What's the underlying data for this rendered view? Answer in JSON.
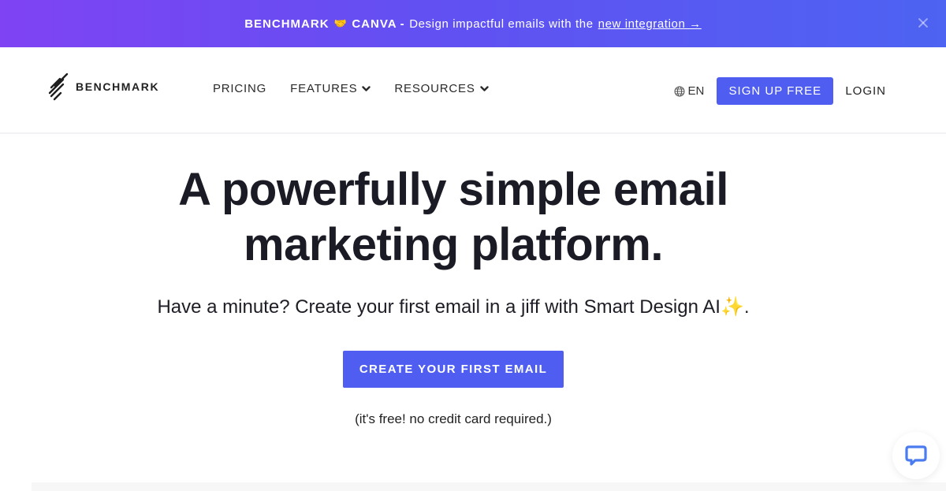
{
  "promo": {
    "brand_left": "BENCHMARK",
    "handshake_icon": "🤝",
    "brand_right": "CANVA",
    "separator": "-",
    "message": "Design impactful emails with the",
    "link_text": "new integration →",
    "close_icon": "close-icon",
    "colors": {
      "gradient_start": "#7f43f3",
      "gradient_end": "#4d63f2"
    }
  },
  "header": {
    "logo_text": "BENCHMARK",
    "nav": [
      {
        "label": "PRICING",
        "has_dropdown": false
      },
      {
        "label": "FEATURES",
        "has_dropdown": true
      },
      {
        "label": "RESOURCES",
        "has_dropdown": true
      }
    ],
    "language": "EN",
    "signup_label": "SIGN UP FREE",
    "login_label": "LOGIN"
  },
  "hero": {
    "title_line1": "A powerfully simple email",
    "title_line2": "marketing platform.",
    "subtitle": "Have a minute? Create your first email in a jiff with Smart Design AI",
    "sparkle": "✨",
    "subtitle_end": ".",
    "cta_label": "CREATE YOUR FIRST EMAIL",
    "cta_note": "(it's free! no credit card required.)"
  },
  "colors": {
    "accent": "#4f5ef0",
    "text": "#1b1b26",
    "chat_icon": "#4a7cf0"
  }
}
